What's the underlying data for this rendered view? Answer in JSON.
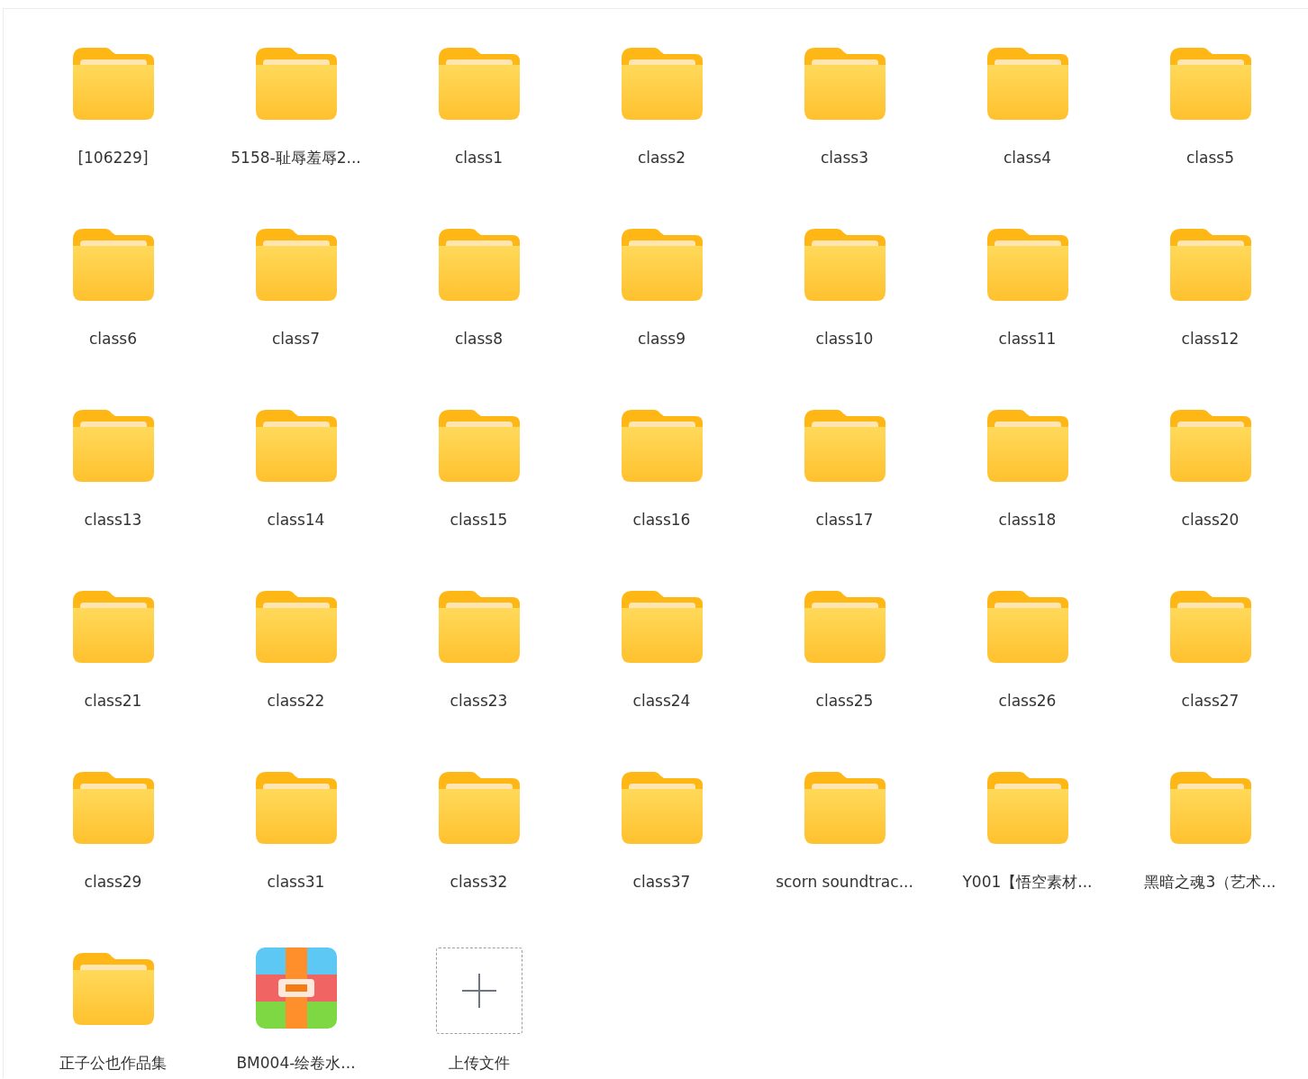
{
  "files": [
    {
      "kind": "folder",
      "name": "[106229]"
    },
    {
      "kind": "folder",
      "name": "5158-耻辱羞辱2..."
    },
    {
      "kind": "folder",
      "name": "class1"
    },
    {
      "kind": "folder",
      "name": "class2"
    },
    {
      "kind": "folder",
      "name": "class3"
    },
    {
      "kind": "folder",
      "name": "class4"
    },
    {
      "kind": "folder",
      "name": "class5"
    },
    {
      "kind": "folder",
      "name": "class6"
    },
    {
      "kind": "folder",
      "name": "class7"
    },
    {
      "kind": "folder",
      "name": "class8"
    },
    {
      "kind": "folder",
      "name": "class9"
    },
    {
      "kind": "folder",
      "name": "class10"
    },
    {
      "kind": "folder",
      "name": "class11"
    },
    {
      "kind": "folder",
      "name": "class12"
    },
    {
      "kind": "folder",
      "name": "class13"
    },
    {
      "kind": "folder",
      "name": "class14"
    },
    {
      "kind": "folder",
      "name": "class15"
    },
    {
      "kind": "folder",
      "name": "class16"
    },
    {
      "kind": "folder",
      "name": "class17"
    },
    {
      "kind": "folder",
      "name": "class18"
    },
    {
      "kind": "folder",
      "name": "class20"
    },
    {
      "kind": "folder",
      "name": "class21"
    },
    {
      "kind": "folder",
      "name": "class22"
    },
    {
      "kind": "folder",
      "name": "class23"
    },
    {
      "kind": "folder",
      "name": "class24"
    },
    {
      "kind": "folder",
      "name": "class25"
    },
    {
      "kind": "folder",
      "name": "class26"
    },
    {
      "kind": "folder",
      "name": "class27"
    },
    {
      "kind": "folder",
      "name": "class29"
    },
    {
      "kind": "folder",
      "name": "class31"
    },
    {
      "kind": "folder",
      "name": "class32"
    },
    {
      "kind": "folder",
      "name": "class37"
    },
    {
      "kind": "folder",
      "name": "scorn soundtrac..."
    },
    {
      "kind": "folder",
      "name": "Y001【悟空素材..."
    },
    {
      "kind": "folder",
      "name": "黑暗之魂3（艺术..."
    },
    {
      "kind": "folder",
      "name": "正子公也作品集"
    },
    {
      "kind": "archive",
      "name": "BM004-绘卷水..."
    },
    {
      "kind": "upload",
      "name": "上传文件"
    }
  ]
}
